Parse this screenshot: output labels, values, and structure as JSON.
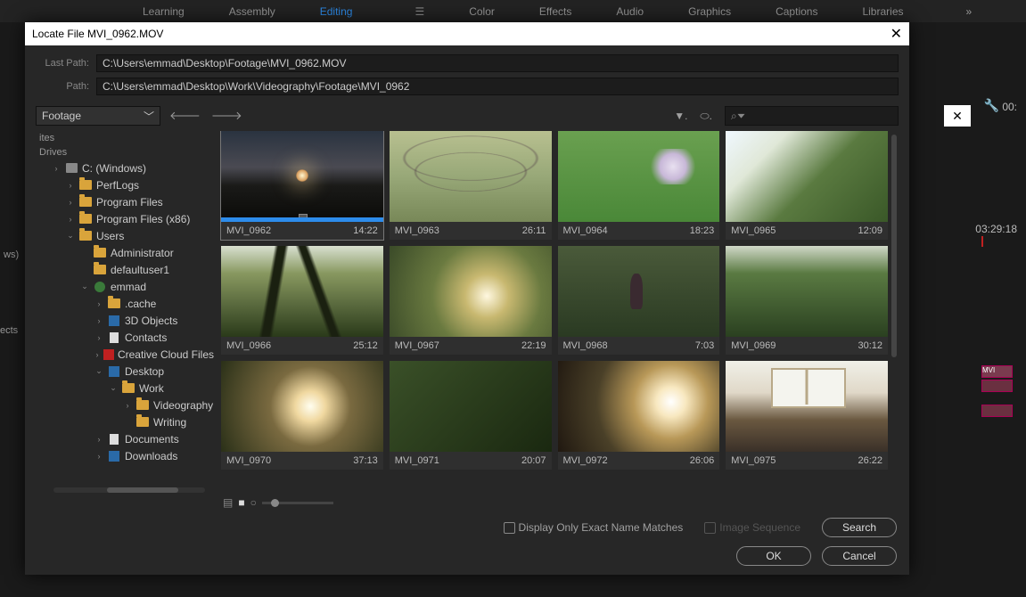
{
  "workspace_tabs": [
    "Learning",
    "Assembly",
    "Editing",
    "Color",
    "Effects",
    "Audio",
    "Graphics",
    "Captions",
    "Libraries"
  ],
  "workspace_active_index": 2,
  "bg": {
    "timecode_top": "00:",
    "timecode": "03:29:18",
    "clip": "MVI"
  },
  "bg_side": {
    "label": "ws)",
    "label2": "ects"
  },
  "dialog": {
    "title": "Locate File MVI_0962.MOV",
    "last_path_label": "Last Path:",
    "last_path": "C:\\Users\\emmad\\Desktop\\Footage\\MVI_0962.MOV",
    "path_label": "Path:",
    "path": "C:\\Users\\emmad\\Desktop\\Work\\Videography\\Footage\\MVI_0962",
    "folder_dropdown": "Footage",
    "search_placeholder": "",
    "checkbox1": "Display Only Exact Name Matches",
    "checkbox2": "Image Sequence",
    "btn_search": "Search",
    "btn_ok": "OK",
    "btn_cancel": "Cancel"
  },
  "tree": {
    "hdr1": "ites",
    "hdr2": "Drives",
    "nodes": [
      {
        "d": 1,
        "tw": ">",
        "ic": "disk",
        "label": "C: (Windows)"
      },
      {
        "d": 2,
        "tw": ">",
        "ic": "folder",
        "label": "PerfLogs"
      },
      {
        "d": 2,
        "tw": ">",
        "ic": "folder",
        "label": "Program Files"
      },
      {
        "d": 2,
        "tw": ">",
        "ic": "folder",
        "label": "Program Files (x86)"
      },
      {
        "d": 2,
        "tw": "v",
        "ic": "folder",
        "label": "Users"
      },
      {
        "d": 3,
        "tw": "",
        "ic": "folder",
        "label": "Administrator"
      },
      {
        "d": 3,
        "tw": "",
        "ic": "folder",
        "label": "defaultuser1"
      },
      {
        "d": 3,
        "tw": "v",
        "ic": "user",
        "label": "emmad"
      },
      {
        "d": 4,
        "tw": ">",
        "ic": "folder",
        "label": ".cache"
      },
      {
        "d": 4,
        "tw": ">",
        "ic": "obj",
        "label": "3D Objects"
      },
      {
        "d": 4,
        "tw": ">",
        "ic": "doc",
        "label": "Contacts"
      },
      {
        "d": 4,
        "tw": ">",
        "ic": "cc",
        "label": "Creative Cloud Files"
      },
      {
        "d": 4,
        "tw": "v",
        "ic": "obj",
        "label": "Desktop"
      },
      {
        "d": 5,
        "tw": "v",
        "ic": "folder",
        "label": "Work"
      },
      {
        "d": 6,
        "tw": ">",
        "ic": "folder",
        "label": "Videography"
      },
      {
        "d": 6,
        "tw": "",
        "ic": "folder",
        "label": "Writing"
      },
      {
        "d": 4,
        "tw": ">",
        "ic": "doc",
        "label": "Documents"
      },
      {
        "d": 4,
        "tw": ">",
        "ic": "dl",
        "label": "Downloads"
      }
    ]
  },
  "tiles": [
    {
      "name": "MVI_0962",
      "dur": "14:22",
      "sel": true,
      "th": "th-dusk"
    },
    {
      "name": "MVI_0963",
      "dur": "26:11",
      "th": "th-ropes"
    },
    {
      "name": "MVI_0964",
      "dur": "18:23",
      "th": "th-grass"
    },
    {
      "name": "MVI_0965",
      "dur": "12:09",
      "th": "th-foliage"
    },
    {
      "name": "MVI_0966",
      "dur": "25:12",
      "th": "th-tree"
    },
    {
      "name": "MVI_0967",
      "dur": "22:19",
      "th": "th-bokeh"
    },
    {
      "name": "MVI_0968",
      "dur": "7:03",
      "th": "th-path"
    },
    {
      "name": "MVI_0969",
      "dur": "30:12",
      "th": "th-bush"
    },
    {
      "name": "MVI_0970",
      "dur": "37:13",
      "th": "th-glow"
    },
    {
      "name": "MVI_0971",
      "dur": "20:07",
      "th": "th-leaf"
    },
    {
      "name": "MVI_0972",
      "dur": "26:06",
      "th": "th-flare"
    },
    {
      "name": "MVI_0975",
      "dur": "26:22",
      "th": "th-window"
    }
  ]
}
